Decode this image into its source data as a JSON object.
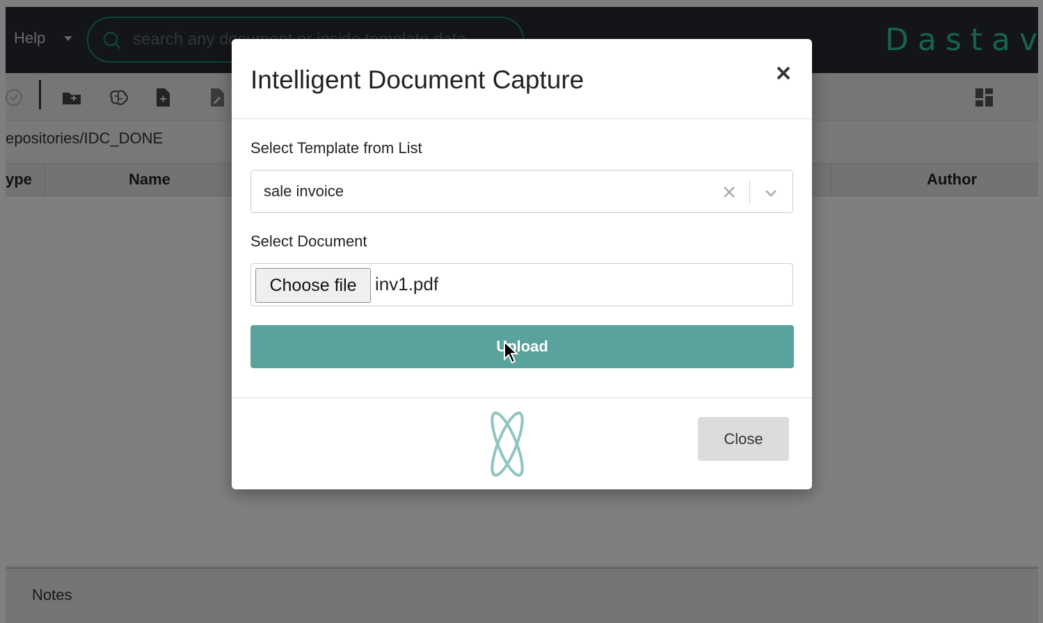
{
  "app": {
    "help_label": "Help",
    "search_placeholder": "search any document or inside template data",
    "brand": "Dastave",
    "breadcrumb": "epositories/IDC_DONE",
    "columns": {
      "type": "ype",
      "name": "Name",
      "author": "Author"
    },
    "notes_label": "Notes"
  },
  "modal": {
    "title": "Intelligent Document Capture",
    "template_label": "Select Template from List",
    "template_value": "sale invoice",
    "document_label": "Select Document",
    "choose_file_label": "Choose file",
    "file_name": "inv1.pdf",
    "upload_label": "Upload",
    "close_label": "Close"
  },
  "colors": {
    "accent": "#5aa39d",
    "brand": "#2ec4a3",
    "topbar": "#262a33"
  },
  "icons": [
    "search-icon",
    "check-circle-icon",
    "folder-add-icon",
    "brain-icon",
    "file-add-icon",
    "file-edit-icon",
    "grid-view-icon",
    "close-icon",
    "clear-icon",
    "chevron-down-icon",
    "cursor-icon",
    "app-logo-icon"
  ]
}
